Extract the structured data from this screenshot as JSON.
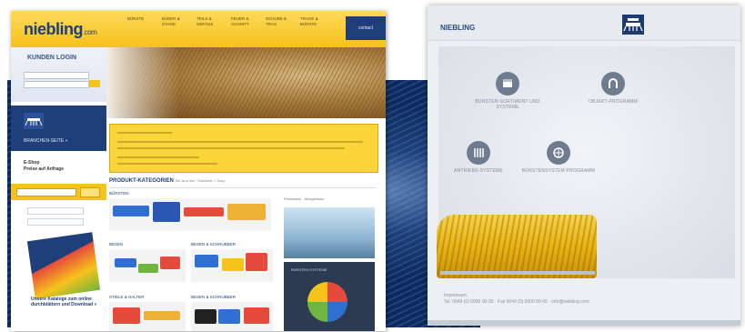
{
  "main_page": {
    "logo": "niebling",
    "logo_suffix": ".com",
    "nav": [
      "BÜRSTE",
      "BÄDER & STAND",
      "TEILS & GEFÄSS",
      "FEUER & SCHNITT",
      "SCHUBE & TRAG",
      "TRAGE & BÜRSTE"
    ],
    "contact_button": "contact",
    "login_title": "KUNDEN LOGIN",
    "sidebar_link": "BRANCHEN-SEITE »",
    "sidebar_text_1": "E-Shop",
    "sidebar_text_2": "Preise auf Anfrage",
    "catalog_label": "Unsere Kataloge zum online durchblättern und Download »",
    "section_title": "PRODUKT-KATEGORIEN",
    "section_subtitle": "Sie sind hier: Startseite > Shop",
    "product_labels": [
      "BÜRSTEN",
      "BESEN",
      "BESEN & SCHRUBBER",
      "STIELE & HALTER",
      "BESEN & SCHRUBBER"
    ],
    "side_photo_title": "Produktion - Anlagenbau",
    "side_card_title": "BÜRSTEN SYSTEME"
  },
  "right_page": {
    "brand": "NIEBLING",
    "nodes": [
      {
        "label": "BÜRSTEN-SORTIMENT UND SYSTEME"
      },
      {
        "label": "OBJEKT-PROGRAMM"
      },
      {
        "label": "ANTRIEBS-SYSTEME"
      },
      {
        "label": "BÜRSTENSYSTEM PROGRAMM"
      }
    ],
    "footer_line_1": "Impressum",
    "footer_line_2": "Tel. 0049 (0) 0000 00-00 · Fax 0049 (0) 0000 00-00 · info@niebling.com"
  },
  "colors": {
    "brand_yellow": "#f6c21c",
    "brand_blue": "#1f3f7a",
    "accent_red": "#e64a3a",
    "accent_green": "#6fb53f"
  }
}
